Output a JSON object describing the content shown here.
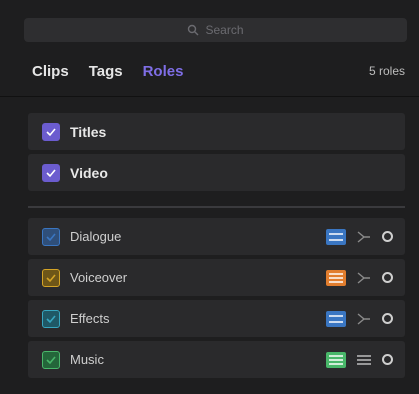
{
  "search": {
    "placeholder": "Search"
  },
  "tabs": [
    {
      "label": "Clips",
      "active": false
    },
    {
      "label": "Tags",
      "active": false
    },
    {
      "label": "Roles",
      "active": true
    }
  ],
  "tab_count": "5 roles",
  "video_roles": [
    {
      "label": "Titles",
      "checked": true,
      "color": "#6b5ccf"
    },
    {
      "label": "Video",
      "checked": true,
      "color": "#6b5ccf"
    }
  ],
  "audio_roles": [
    {
      "label": "Dialogue",
      "checked": true,
      "color": "#3a76c2",
      "lane_color": "#3a76c2",
      "expand_icon": "collapse-icon"
    },
    {
      "label": "Voiceover",
      "checked": true,
      "color": "#d5a426",
      "lane_color": "#e17d2e",
      "expand_icon": "collapse-icon"
    },
    {
      "label": "Effects",
      "checked": true,
      "color": "#37a6c0",
      "lane_color": "#3a76c2",
      "expand_icon": "collapse-icon"
    },
    {
      "label": "Music",
      "checked": true,
      "color": "#49b76a",
      "lane_color": "#49b76a",
      "expand_icon": "lanes-icon"
    }
  ],
  "colors": {
    "accent": "#7f6ee6",
    "background": "#1e1e1f",
    "row": "#2a2a2c"
  }
}
